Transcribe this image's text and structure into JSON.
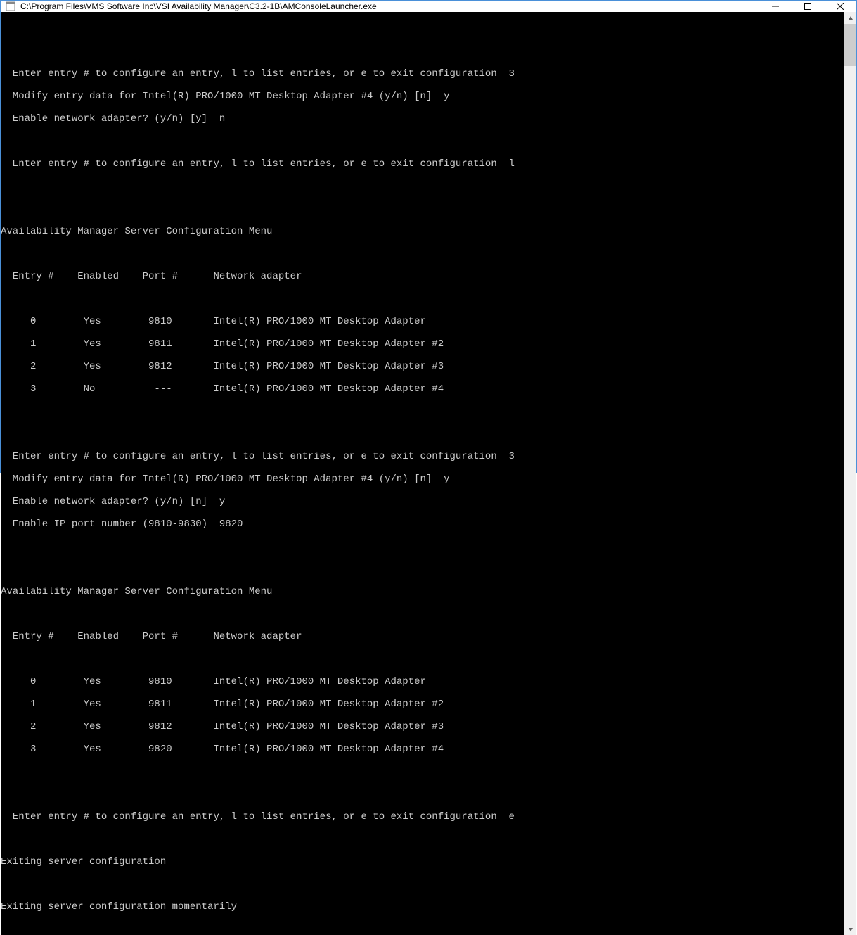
{
  "window": {
    "title": "C:\\Program Files\\VMS Software Inc\\VSI Availability Manager\\C3.2-1B\\AMConsoleLauncher.exe"
  },
  "console": {
    "session1": {
      "prompt1": "  Enter entry # to configure an entry, l to list entries, or e to exit configuration  3",
      "prompt2": "  Modify entry data for Intel(R) PRO/1000 MT Desktop Adapter #4 (y/n) [n]  y",
      "prompt3": "  Enable network adapter? (y/n) [y]  n",
      "prompt4": "  Enter entry # to configure an entry, l to list entries, or e to exit configuration  l"
    },
    "menu1": {
      "title": "Availability Manager Server Configuration Menu",
      "header": "  Entry #    Enabled    Port #      Network adapter",
      "row0": "     0        Yes        9810       Intel(R) PRO/1000 MT Desktop Adapter",
      "row1": "     1        Yes        9811       Intel(R) PRO/1000 MT Desktop Adapter #2",
      "row2": "     2        Yes        9812       Intel(R) PRO/1000 MT Desktop Adapter #3",
      "row3": "     3        No          ---       Intel(R) PRO/1000 MT Desktop Adapter #4"
    },
    "session2": {
      "prompt1": "  Enter entry # to configure an entry, l to list entries, or e to exit configuration  3",
      "prompt2": "  Modify entry data for Intel(R) PRO/1000 MT Desktop Adapter #4 (y/n) [n]  y",
      "prompt3": "  Enable network adapter? (y/n) [n]  y",
      "prompt4": "  Enable IP port number (9810-9830)  9820"
    },
    "menu2": {
      "title": "Availability Manager Server Configuration Menu",
      "header": "  Entry #    Enabled    Port #      Network adapter",
      "row0": "     0        Yes        9810       Intel(R) PRO/1000 MT Desktop Adapter",
      "row1": "     1        Yes        9811       Intel(R) PRO/1000 MT Desktop Adapter #2",
      "row2": "     2        Yes        9812       Intel(R) PRO/1000 MT Desktop Adapter #3",
      "row3": "     3        Yes        9820       Intel(R) PRO/1000 MT Desktop Adapter #4"
    },
    "session3": {
      "prompt1": "  Enter entry # to configure an entry, l to list entries, or e to exit configuration  e"
    },
    "exit1": "Exiting server configuration",
    "exit2": "Exiting server configuration momentarily"
  }
}
